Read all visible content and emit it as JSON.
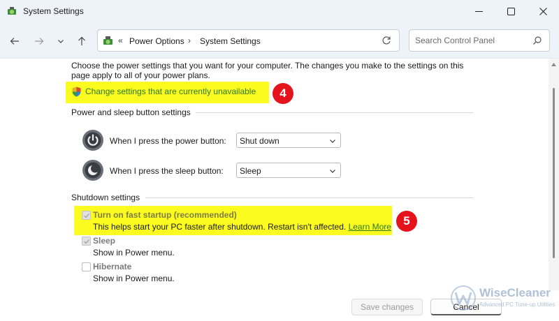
{
  "window": {
    "title": "System Settings"
  },
  "address": {
    "overflow": "«",
    "separator": "›",
    "crumbs": [
      "Power Options",
      "System Settings"
    ]
  },
  "search": {
    "placeholder": "Search Control Panel"
  },
  "intro": "Choose the power settings that you want for your computer. The changes you make to the settings on this page apply to all of your power plans.",
  "change_link": "Change settings that are currently unavailable",
  "badges": {
    "step4": "4",
    "step5": "5"
  },
  "highlight_color": "#fbfb1f",
  "badge_color": "#e5141c",
  "link_color": "#2a7a23",
  "power_section": {
    "heading": "Power and sleep button settings",
    "power_label": "When I press the power button:",
    "power_value": "Shut down",
    "sleep_label": "When I press the sleep button:",
    "sleep_value": "Sleep"
  },
  "shutdown_section": {
    "heading": "Shutdown settings",
    "fast_startup": {
      "title": "Turn on fast startup (recommended)",
      "desc": "This helps start your PC faster after shutdown. Restart isn't affected.",
      "link": "Learn More",
      "checked": true
    },
    "sleep": {
      "title": "Sleep",
      "desc": "Show in Power menu.",
      "checked": true
    },
    "hibernate": {
      "title": "Hibernate",
      "desc": "Show in Power menu.",
      "checked": false
    }
  },
  "footer": {
    "save": "Save changes",
    "cancel": "Cancel"
  },
  "watermark": {
    "name": "WiseCleaner",
    "tagline": "Advanced PC Tune-up Utilities"
  }
}
